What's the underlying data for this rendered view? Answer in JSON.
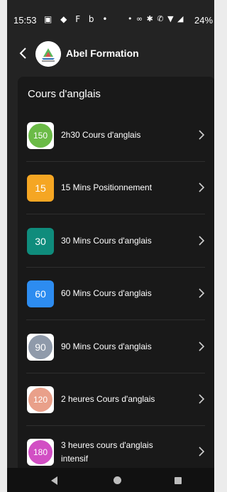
{
  "status_bar": {
    "time": "15:53",
    "left_icons": "▣ ◆ F b •",
    "right_icons": "• ∞ ✱ ✆ ▼ ◢",
    "battery": "24%"
  },
  "app_bar": {
    "title": "Abel Formation",
    "logo_text": "Abel Formation"
  },
  "section": {
    "title": "Cours d'anglais",
    "items": [
      {
        "badge": "150",
        "label": "2h30 Cours d'anglais",
        "style": "white",
        "color": "#6bbb47"
      },
      {
        "badge": "15",
        "label": "15 Mins Positionnement",
        "style": "solid",
        "color": "#f5a623"
      },
      {
        "badge": "30",
        "label": "30 Mins Cours d'anglais",
        "style": "solid",
        "color": "#0f8c7c"
      },
      {
        "badge": "60",
        "label": "60 Mins Cours d'anglais",
        "style": "solid",
        "color": "#2d8cf0"
      },
      {
        "badge": "90",
        "label": "90 Mins Cours d'anglais",
        "style": "white",
        "color": "#8f9aaa"
      },
      {
        "badge": "120",
        "label": "2 heures Cours d'anglais",
        "style": "white",
        "color": "#e9a08a"
      },
      {
        "badge": "180",
        "label": "3 heures cours d'anglais intensif",
        "style": "white",
        "color": "#d24fc4"
      }
    ]
  }
}
